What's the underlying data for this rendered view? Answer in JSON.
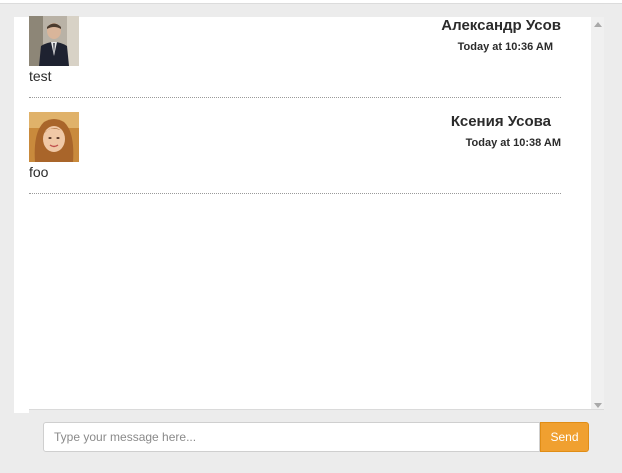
{
  "messages": [
    {
      "author": "Александр Усов",
      "time": "Today at 10:36 AM",
      "text": "test",
      "avatar_icon": "user-photo-man-suit"
    },
    {
      "author": "Ксения Усова",
      "time": "Today at 10:38 AM",
      "text": "foo",
      "avatar_icon": "user-photo-woman-red-hair"
    }
  ],
  "composer": {
    "placeholder": "Type your message here...",
    "value": "",
    "send_label": "Send"
  },
  "colors": {
    "send_button": "#f0a030",
    "text": "#2b2b2b",
    "panel_background": "#ececec"
  }
}
